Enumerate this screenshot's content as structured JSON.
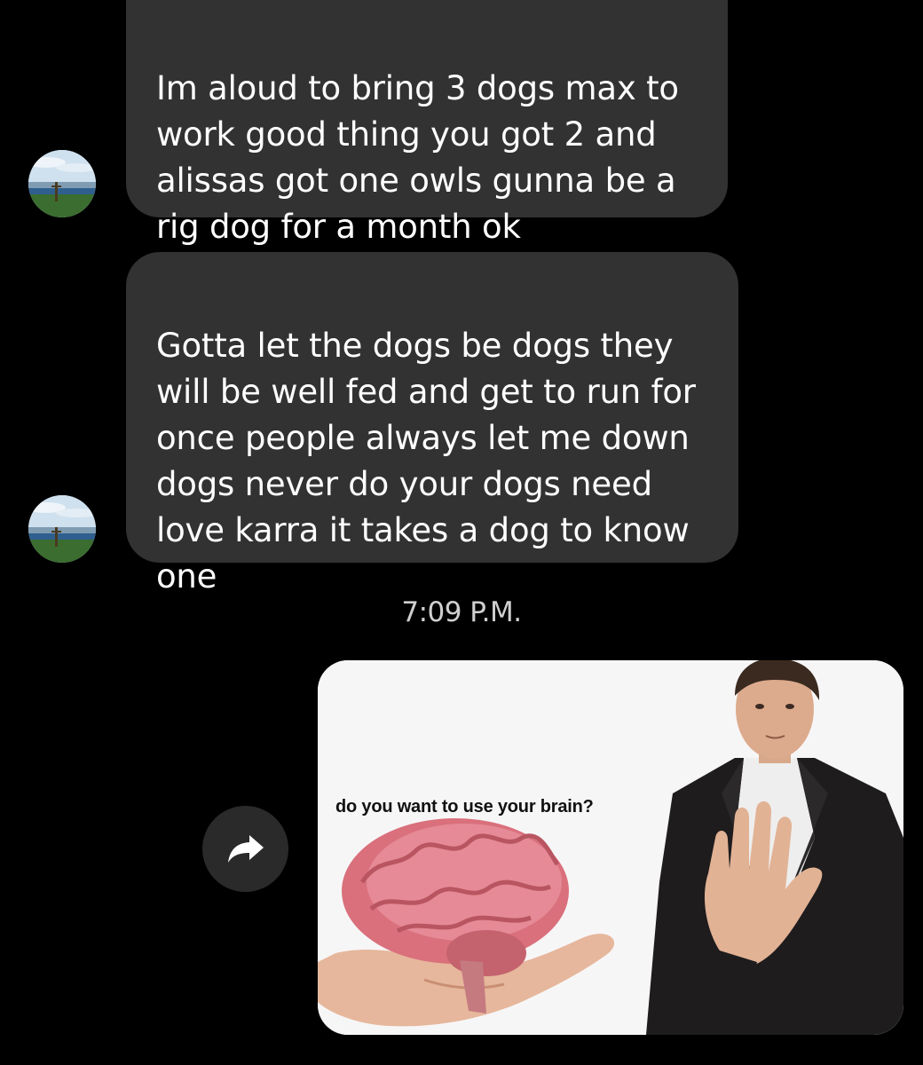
{
  "messages": [
    {
      "sender": "received",
      "text": "Im aloud to bring 3 dogs max to\nwork good thing you got 2 and\nalissas got one owls gunna be a\nrig dog for a month ok"
    },
    {
      "sender": "received",
      "text": "Gotta let the dogs be dogs they\nwill be well fed and get to run for\nonce people always let me down\ndogs never do your dogs need\nlove karra it takes a dog to know\none"
    }
  ],
  "timestamp": "7:09 P.M.",
  "sent_image": {
    "caption": "do you want to use your brain?",
    "icon": "share-icon"
  },
  "colors": {
    "background": "#000000",
    "bubble": "#323232",
    "text": "#ffffff",
    "timestamp": "#cfcfcf",
    "share_button": "#2a2a2a"
  }
}
